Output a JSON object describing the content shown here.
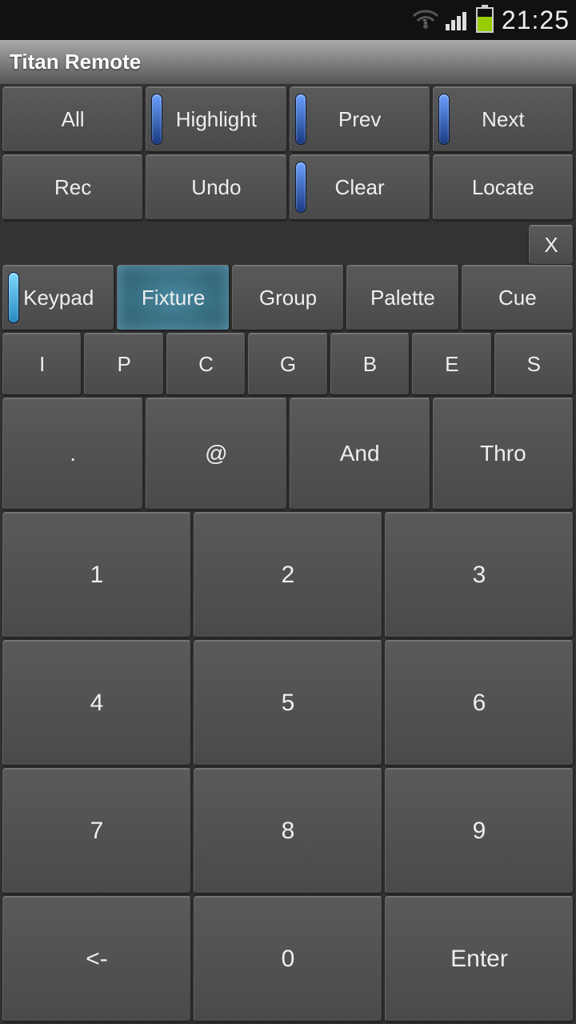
{
  "status": {
    "time": "21:25"
  },
  "title": "Titan Remote",
  "toprow1": {
    "all": "All",
    "highlight": "Highlight",
    "prev": "Prev",
    "next": "Next"
  },
  "toprow2": {
    "rec": "Rec",
    "undo": "Undo",
    "clear": "Clear",
    "locate": "Locate"
  },
  "close": "X",
  "modes": {
    "keypad": "Keypad",
    "fixture": "Fixture",
    "group": "Group",
    "palette": "Palette",
    "cue": "Cue"
  },
  "letters": [
    "I",
    "P",
    "C",
    "G",
    "B",
    "E",
    "S"
  ],
  "ops": {
    "dot": ".",
    "at": "@",
    "and": "And",
    "thro": "Thro"
  },
  "numpad": {
    "r1": [
      "1",
      "2",
      "3"
    ],
    "r2": [
      "4",
      "5",
      "6"
    ],
    "r3": [
      "7",
      "8",
      "9"
    ],
    "r4": [
      "<-",
      "0",
      "Enter"
    ]
  }
}
